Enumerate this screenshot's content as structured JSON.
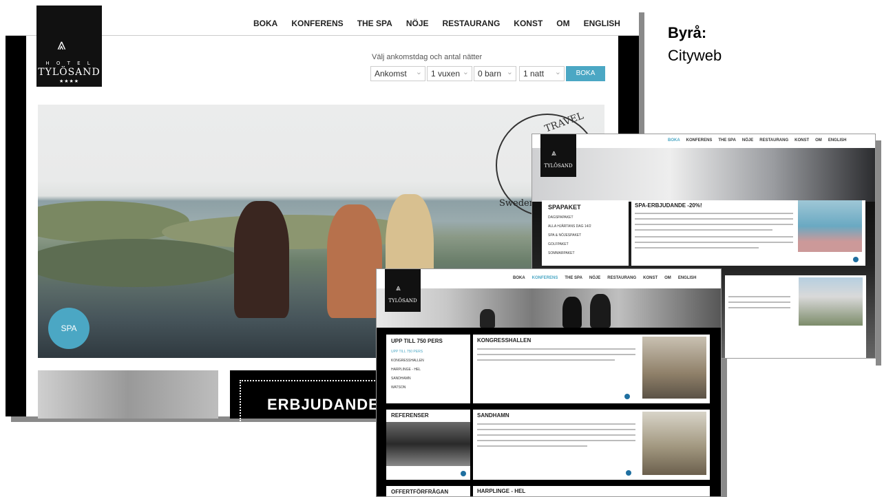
{
  "main_site": {
    "logo": {
      "hotel": "H O T E L",
      "name": "TYLÖSAND",
      "stars": "★★★★"
    },
    "nav": [
      "BOKA",
      "KONFERENS",
      "THE SPA",
      "NÖJE",
      "RESTAURANG",
      "KONST",
      "OM",
      "ENGLISH"
    ],
    "booking": {
      "label": "Välj ankomstdag och antal nätter",
      "arrival": "Ankomst",
      "adults": "1 vuxen",
      "children": "0 barn",
      "nights": "1 natt",
      "button": "BOKA"
    },
    "hero_badge": "SPA",
    "award": {
      "top": "TRAVEL",
      "country": "Sweden"
    },
    "offer_banner": "ERBJUDANDE!"
  },
  "agency": {
    "label": "Byrå:",
    "value": "Cityweb"
  },
  "spa_page": {
    "nav": [
      "BOKA",
      "KONFERENS",
      "THE SPA",
      "NÖJE",
      "RESTAURANG",
      "KONST",
      "OM",
      "ENGLISH"
    ],
    "menu_title": "SPAPAKET",
    "menu_items": [
      "DAGSPAPAKET",
      "ALLA HJÄRTANS DAG 14/2",
      "SPA & NÖJESPAKET",
      "GOLFPAKET",
      "SOMMARPAKET"
    ],
    "offer_title": "SPA-ERBJUDANDE -20%!"
  },
  "conference_page": {
    "nav": [
      "BOKA",
      "KONFERENS",
      "THE SPA",
      "NÖJE",
      "RESTAURANG",
      "KONST",
      "OM",
      "ENGLISH"
    ],
    "menu_title": "UPP TILL 750 PERS",
    "menu_items": [
      "UPP TILL 750 PERS",
      "KONGRESSHALLEN",
      "HARPLINGE - HEL",
      "SANDHAMN",
      "WATSON"
    ],
    "section1_title": "KONGRESSHALLEN",
    "section2_title": "SANDHAMN",
    "section3_title": "HARPLINGE - HEL",
    "refs_title": "REFERENSER",
    "offer_title": "OFFERTFÖRFRÅGAN"
  },
  "colors": {
    "accent": "#4ba7c4",
    "dark": "#111111"
  }
}
